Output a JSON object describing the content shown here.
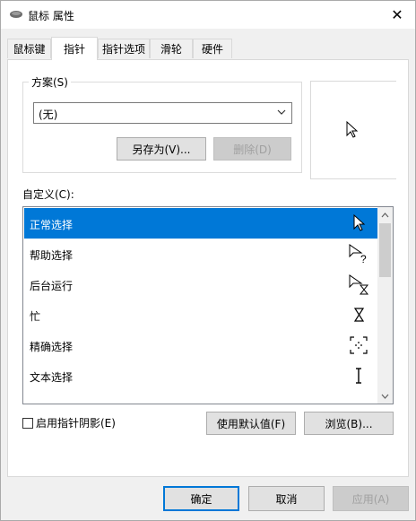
{
  "window": {
    "title": "鼠标 属性",
    "close_symbol": "✕"
  },
  "tabs": [
    {
      "label": "鼠标键",
      "active": false
    },
    {
      "label": "指针",
      "active": true
    },
    {
      "label": "指针选项",
      "active": false
    },
    {
      "label": "滑轮",
      "active": false
    },
    {
      "label": "硬件",
      "active": false
    }
  ],
  "scheme": {
    "legend": "方案(S)",
    "selected": "(无)",
    "save_as_label": "另存为(V)...",
    "delete_label": "删除(D)"
  },
  "customize": {
    "label": "自定义(C):",
    "items": [
      {
        "label": "正常选择",
        "icon": "arrow-cursor-icon",
        "selected": true
      },
      {
        "label": "帮助选择",
        "icon": "help-cursor-icon",
        "selected": false
      },
      {
        "label": "后台运行",
        "icon": "working-cursor-icon",
        "selected": false
      },
      {
        "label": "忙",
        "icon": "busy-hourglass-icon",
        "selected": false
      },
      {
        "label": "精确选择",
        "icon": "precision-crosshair-icon",
        "selected": false
      },
      {
        "label": "文本选择",
        "icon": "text-ibeam-icon",
        "selected": false
      }
    ]
  },
  "options": {
    "shadow_label": "启用指针阴影(E)",
    "shadow_checked": false,
    "use_default_label": "使用默认值(F)",
    "browse_label": "浏览(B)..."
  },
  "footer": {
    "ok_label": "确定",
    "cancel_label": "取消",
    "apply_label": "应用(A)"
  },
  "colors": {
    "accent": "#0078d7"
  }
}
